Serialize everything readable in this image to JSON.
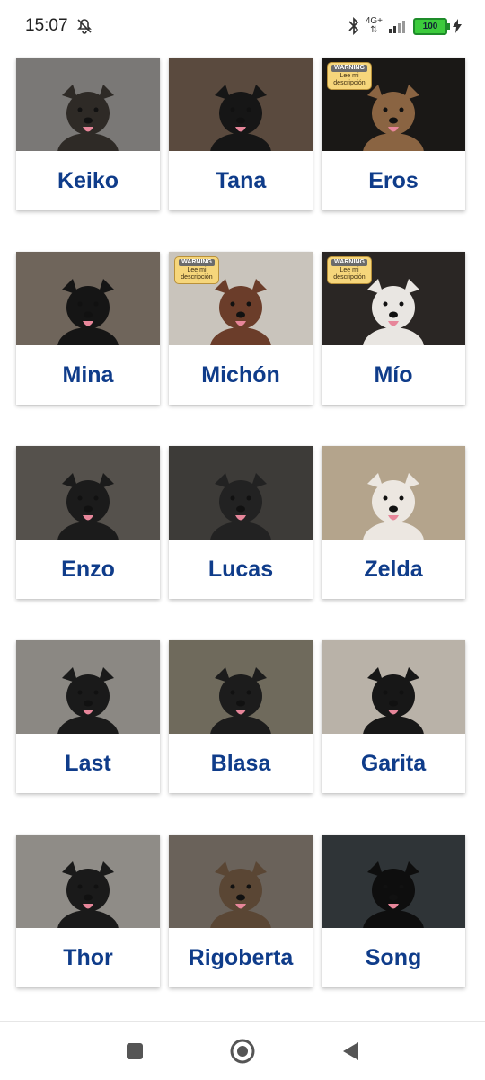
{
  "status_bar": {
    "time": "15:07",
    "network": "4G+",
    "battery": "100",
    "icons": [
      "bell-off-icon",
      "bluetooth-icon",
      "signal-icon",
      "battery-icon",
      "charging-icon"
    ]
  },
  "dogs": [
    {
      "name": "Keiko",
      "bg": "#7a7876",
      "dog": "#2e2a26",
      "warning": false
    },
    {
      "name": "Tana",
      "bg": "#5a4a3e",
      "dog": "#161616",
      "warning": false
    },
    {
      "name": "Eros",
      "bg": "#1a1816",
      "dog": "#8a6442",
      "warning": true
    },
    {
      "name": "Mina",
      "bg": "#6f655b",
      "dog": "#151515",
      "warning": false
    },
    {
      "name": "Michón",
      "bg": "#c9c4bc",
      "dog": "#6b3d2a",
      "warning": true
    },
    {
      "name": "Mío",
      "bg": "#2a2624",
      "dog": "#e9e6e2",
      "warning": true
    },
    {
      "name": "Enzo",
      "bg": "#55514c",
      "dog": "#1b1b1b",
      "warning": false
    },
    {
      "name": "Lucas",
      "bg": "#3d3b38",
      "dog": "#222",
      "warning": false
    },
    {
      "name": "Zelda",
      "bg": "#b4a48c",
      "dog": "#ece7e1",
      "warning": false
    },
    {
      "name": "Last",
      "bg": "#8b8883",
      "dog": "#1a1a1a",
      "warning": false
    },
    {
      "name": "Blasa",
      "bg": "#6f6a5c",
      "dog": "#1c1c1c",
      "warning": false
    },
    {
      "name": "Garita",
      "bg": "#b9b2a8",
      "dog": "#171717",
      "warning": false
    },
    {
      "name": "Thor",
      "bg": "#8f8c87",
      "dog": "#1a1a1a",
      "warning": false
    },
    {
      "name": "Rigoberta",
      "bg": "#6a625a",
      "dog": "#5a4634",
      "warning": false
    },
    {
      "name": "Song",
      "bg": "#2f3437",
      "dog": "#0e0e0e",
      "warning": false
    }
  ],
  "warning_badge": {
    "title": "WARNING",
    "text": "Lee mi descripción"
  },
  "nav": {
    "recents": "recents-square-icon",
    "home": "home-circle-icon",
    "back": "back-triangle-icon"
  }
}
